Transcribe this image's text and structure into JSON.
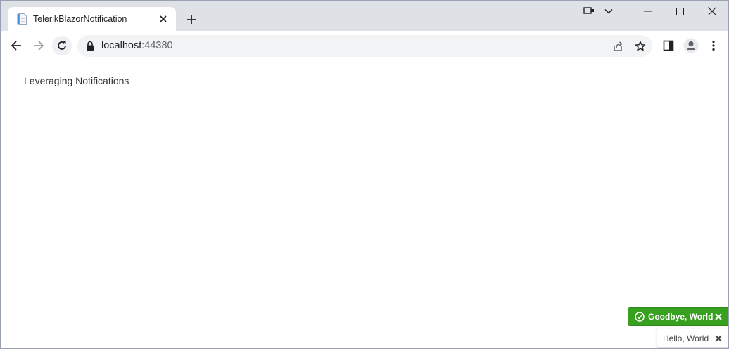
{
  "tab": {
    "title": "TelerikBlazorNotification",
    "close_label": "✕"
  },
  "address": {
    "host": "localhost",
    "port": ":44380"
  },
  "page": {
    "heading": "Leveraging Notifications"
  },
  "notifications": [
    {
      "text": "Goodbye, World",
      "type": "success",
      "icon": "check-circle-icon",
      "color": "#37a01e"
    },
    {
      "text": "Hello, World",
      "type": "none"
    }
  ],
  "colors": {
    "titlebar": "#dee1e6",
    "omnibox": "#f1f3f4",
    "success": "#37a01e"
  }
}
